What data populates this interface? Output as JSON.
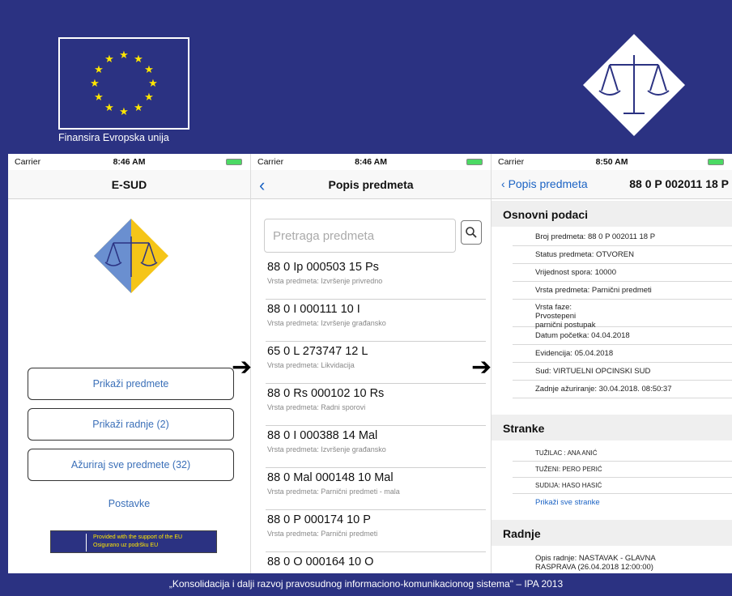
{
  "banner": {
    "eu_caption": "Finansira Evropska unija"
  },
  "screen1": {
    "status": {
      "carrier": "Carrier",
      "time": "8:46 AM"
    },
    "title": "E-SUD",
    "buttons": [
      "Prikaži predmete",
      "Prikaži radnje (2)",
      "Ažuriraj sve predmete (32)"
    ],
    "settings_link": "Postavke",
    "eu_badge_line1": "Provided with the support of the EU",
    "eu_badge_line2": "Osigurano uz podršku EU"
  },
  "screen2": {
    "status": {
      "carrier": "Carrier",
      "time": "8:46 AM"
    },
    "title": "Popis predmeta",
    "search_placeholder": "Pretraga predmeta",
    "cases": [
      {
        "number": "88 0 Ip 000503 15 Ps",
        "type": "Vrsta predmeta: Izvršenje privredno"
      },
      {
        "number": "88 0 I 000111 10 I",
        "type": "Vrsta predmeta: Izvršenje građansko"
      },
      {
        "number": "65 0 L 273747 12 L",
        "type": "Vrsta predmeta: Likvidacija"
      },
      {
        "number": "88 0 Rs 000102 10 Rs",
        "type": "Vrsta predmeta: Radni sporovi"
      },
      {
        "number": "88 0 I 000388 14 Mal",
        "type": "Vrsta predmeta: Izvršenje građansko"
      },
      {
        "number": "88 0 Mal 000148 10 Mal",
        "type": "Vrsta predmeta: Parnični predmeti - mala"
      },
      {
        "number": "88 0 P 000174 10 P",
        "type": "Vrsta predmeta: Parnični predmeti"
      },
      {
        "number": "88 0 O 000164 10 O",
        "type": ""
      }
    ]
  },
  "screen3": {
    "status": {
      "carrier": "Carrier",
      "time": "8:50 AM"
    },
    "back_label": "Popis predmeta",
    "title": "88 0 P 002011 18 P",
    "section_basic": "Osnovni podaci",
    "basic_rows": [
      "Broj predmeta: 88 0 P 002011 18 P",
      "Status predmeta: OTVOREN",
      "Vrijednost spora: 10000",
      "Vrsta predmeta: Parnični predmeti",
      "Vrsta faze: Prvostepeni parnični postupak",
      "Datum početka: 04.04.2018",
      "Evidencija: 05.04.2018",
      "Sud: VIRTUELNI OPCINSKI SUD",
      "Zadnje ažuriranje: 30.04.2018. 08:50:37"
    ],
    "section_parties": "Stranke",
    "parties": [
      "TUŽILAC : ANA ANIĆ",
      "TUŽENI: PERO PERIĆ",
      "SUDIJA: HASO HASIĆ"
    ],
    "show_all_parties": "Prikaži sve stranke",
    "section_actions": "Radnje",
    "action_line1": "Opis radnje: NASTAVAK - GLAVNA",
    "action_line2": "RASPRAVA (26.04.2018 12:00:00)"
  },
  "footer": "„Konsolidacija i dalji razvoj pravosudnog informaciono-komunikacionog sistema\" – IPA 2013",
  "colors": {
    "banner_bg": "#2b3282",
    "link": "#3a6fb8",
    "ios_blue": "#1b63c4",
    "eu_star": "#ffe600"
  }
}
